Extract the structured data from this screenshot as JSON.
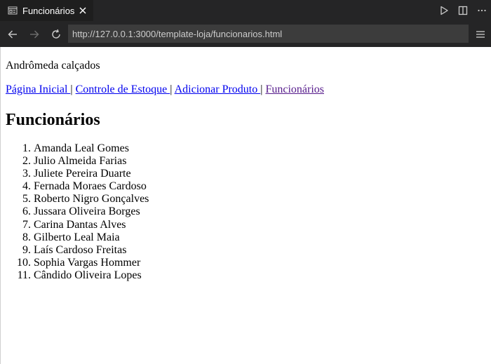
{
  "browser": {
    "tab": {
      "title": "Funcionários",
      "icon": "preview-icon"
    },
    "actions": [
      "run-icon",
      "split-editor-icon",
      "more-icon"
    ],
    "nav": {
      "back_icon": "arrow-left-icon",
      "forward_icon": "arrow-right-icon",
      "reload_icon": "reload-icon",
      "menu_icon": "menu-icon"
    },
    "url": "http://127.0.0.1:3000/template-loja/funcionarios.html"
  },
  "page": {
    "store_name": "Andrômeda calçados",
    "links": [
      {
        "label": "Página Inicial ",
        "visited": false
      },
      {
        "label": "Controle de Estoque ",
        "visited": false
      },
      {
        "label": "Adicionar Produto ",
        "visited": false
      },
      {
        "label": "Funcionários",
        "visited": true
      }
    ],
    "separator": "|",
    "heading": "Funcionários",
    "employees": [
      "Amanda Leal Gomes",
      "Julio Almeida Farias",
      "Juliete Pereira Duarte",
      "Fernada Moraes Cardoso",
      "Roberto Nigro Gonçalves",
      "Jussara Oliveira Borges",
      "Carina Dantas Alves",
      "Gilberto Leal Maia",
      "Laís Cardoso Freitas",
      "Sophia Vargas Hommer",
      "Cândido Oliveira Lopes"
    ]
  },
  "colors": {
    "tabbar_bg": "#252526",
    "active_tab_bg": "#1e1e1e",
    "url_bg": "#3c3c3c",
    "link": "#0000ee",
    "visited_link": "#551a8b"
  }
}
